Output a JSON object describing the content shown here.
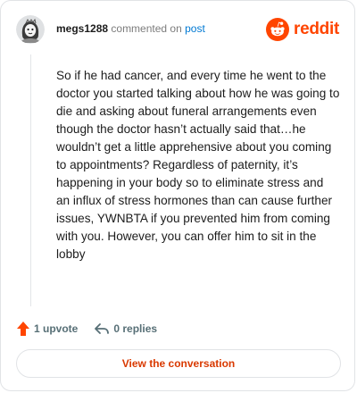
{
  "header": {
    "username": "megs1288",
    "commented_text": "commented on",
    "post_link": "post",
    "logo_text": "reddit"
  },
  "comment": {
    "body": "So if he had cancer, and every time he went to the doctor you started talking about how he was going to die and asking about funeral arrangements even though the doctor hasn’t actually said that…he wouldn’t get a little apprehensive about you coming to appointments? Regardless of paternity, it’s happening in your body so to eliminate stress and an influx of stress hormones than can cause further issues, YWNBTA if you prevented him from coming with you. However, you can offer him to sit in the lobby"
  },
  "actions": {
    "upvote_label": "1 upvote",
    "replies_label": "0 replies"
  },
  "footer": {
    "view_button": "View the conversation"
  },
  "colors": {
    "brand": "#ff4500",
    "link": "#0079d3",
    "button_text": "#d93900"
  }
}
